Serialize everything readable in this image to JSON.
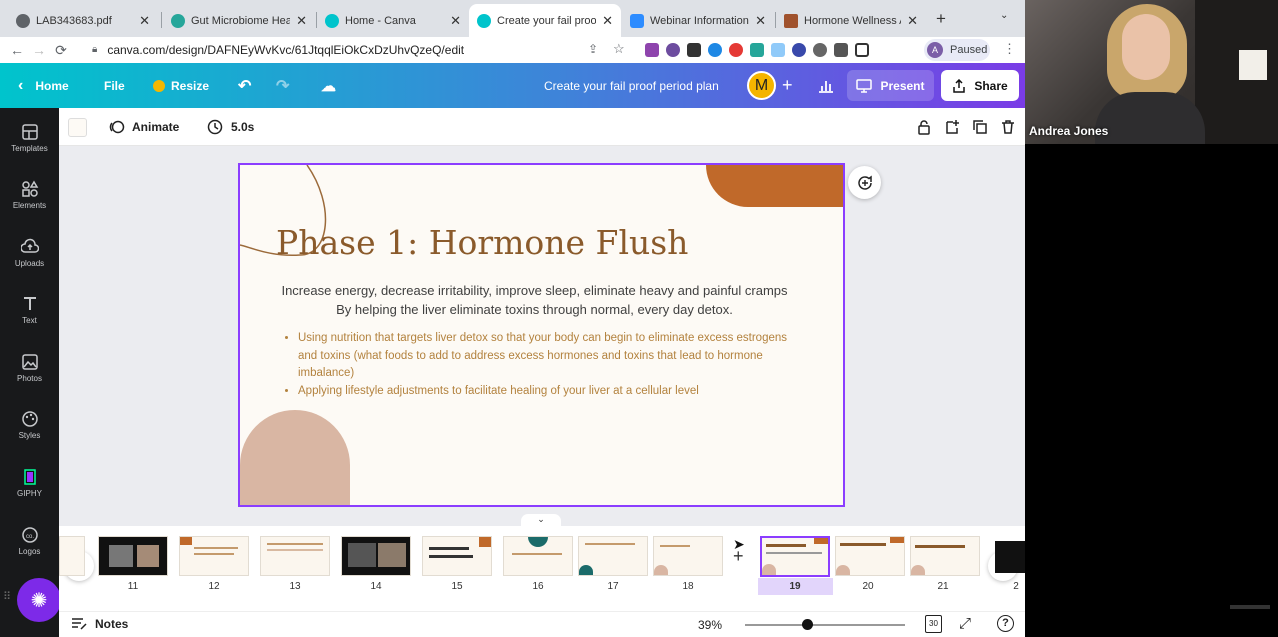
{
  "browser": {
    "tabs": [
      {
        "title": "LAB343683.pdf",
        "icon": "globe-icon",
        "color": "#5f6368"
      },
      {
        "title": "Gut Microbiome Healt",
        "icon": "site-icon",
        "color": "#26a69a"
      },
      {
        "title": "Home - Canva",
        "icon": "canva-icon",
        "color": "#00c4cc"
      },
      {
        "title": "Create your fail proof",
        "icon": "canva-icon",
        "color": "#00c4cc"
      },
      {
        "title": "Webinar Information -",
        "icon": "zoom-icon",
        "color": "#2d8cff"
      },
      {
        "title": "Hormone Wellness Ac",
        "icon": "site-icon",
        "color": "#a0522d"
      }
    ],
    "url": "canva.com/design/DAFNEyWvKvc/61JtqqlEiOkCxDzUhvQzeQ/edit",
    "profile_initial": "A",
    "profile_status": "Paused"
  },
  "header": {
    "home": "Home",
    "file": "File",
    "resize": "Resize",
    "title": "Create your fail proof period plan",
    "avatar": "M",
    "present": "Present",
    "share": "Share"
  },
  "sidebar": [
    {
      "label": "Templates",
      "icon": "templates-icon"
    },
    {
      "label": "Elements",
      "icon": "elements-icon"
    },
    {
      "label": "Uploads",
      "icon": "uploads-icon"
    },
    {
      "label": "Text",
      "icon": "text-icon"
    },
    {
      "label": "Photos",
      "icon": "photos-icon"
    },
    {
      "label": "Styles",
      "icon": "styles-icon"
    },
    {
      "label": "GIPHY",
      "icon": "giphy-icon"
    },
    {
      "label": "Logos",
      "icon": "logos-icon"
    }
  ],
  "toolbar": {
    "animate": "Animate",
    "duration": "5.0s"
  },
  "slide": {
    "title": "Phase 1: Hormone Flush",
    "subtitle_1": "Increase energy, decrease irritability, improve sleep, eliminate heavy and painful cramps",
    "subtitle_2": "By helping the liver eliminate toxins through normal, every day detox.",
    "bullets": [
      "Using nutrition that targets liver detox so that your body can begin to eliminate excess estrogens and toxins (what foods to add to address excess hormones and toxins that lead to hormone imbalance)",
      "Applying lifestyle adjustments to facilitate healing of your liver at a cellular level"
    ],
    "colors": {
      "title": "#8a5a2b",
      "accent_orange": "#c0692a",
      "accent_blush": "#d9b6a3",
      "bullets": "#b3823e"
    }
  },
  "filmstrip": {
    "pages": [
      "11",
      "12",
      "13",
      "14",
      "15",
      "16",
      "17",
      "18",
      "19",
      "20",
      "21",
      "2"
    ],
    "selected": "19"
  },
  "bottom": {
    "notes": "Notes",
    "zoom": "39%",
    "zoom_level": 0.39,
    "page_count": "30"
  },
  "video": {
    "name": "Andrea Jones"
  }
}
